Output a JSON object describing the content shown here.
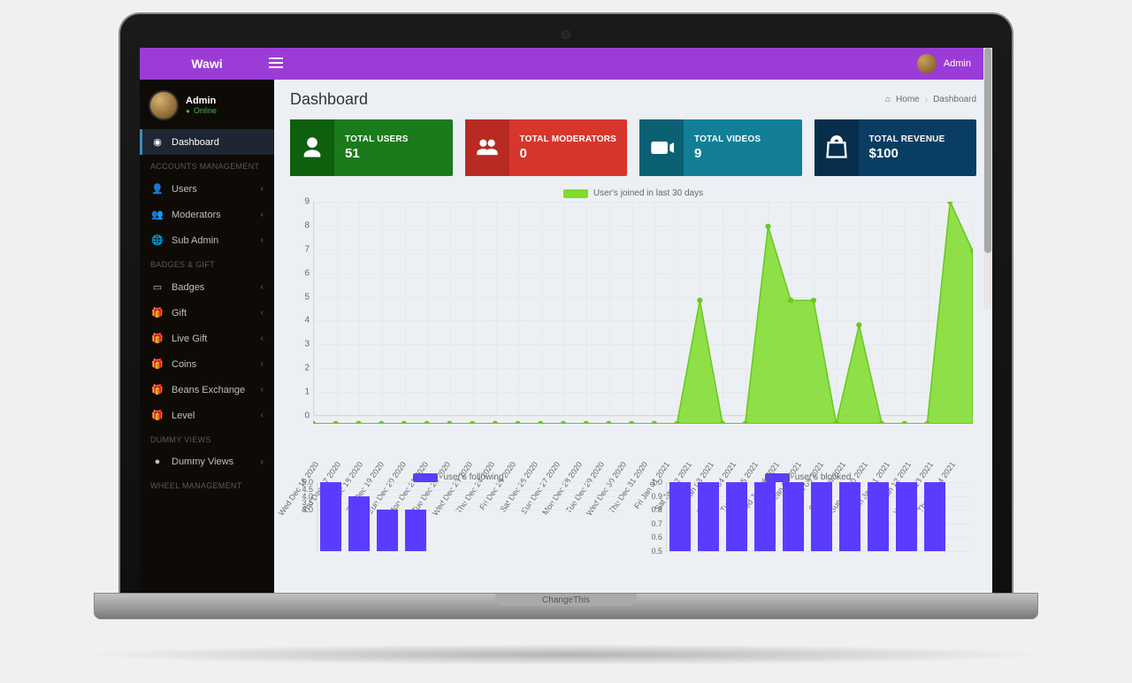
{
  "laptop_base_label": "ChangeThis",
  "topbar": {
    "brand": "Wawi",
    "user_name": "Admin"
  },
  "sidebar": {
    "profile": {
      "name": "Admin",
      "status": "Online"
    },
    "sections": [
      {
        "items": [
          {
            "icon": "dashboard-icon",
            "label": "Dashboard",
            "active": true,
            "expandable": false
          }
        ]
      },
      {
        "header": "ACCOUNTS MANAGEMENT",
        "items": [
          {
            "icon": "user-icon",
            "label": "Users",
            "expandable": true
          },
          {
            "icon": "users-icon",
            "label": "Moderators",
            "expandable": true
          },
          {
            "icon": "globe-icon",
            "label": "Sub Admin",
            "expandable": true
          }
        ]
      },
      {
        "header": "BADGES & GIFT",
        "items": [
          {
            "icon": "book-icon",
            "label": "Badges",
            "expandable": true
          },
          {
            "icon": "gift-icon",
            "label": "Gift",
            "expandable": true
          },
          {
            "icon": "gift-icon",
            "label": "Live Gift",
            "expandable": true
          },
          {
            "icon": "gift-icon",
            "label": "Coins",
            "expandable": true
          },
          {
            "icon": "gift-icon",
            "label": "Beans Exchange",
            "expandable": true
          },
          {
            "icon": "gift-icon",
            "label": "Level",
            "expandable": true
          }
        ]
      },
      {
        "header": "Dummy Views",
        "items": [
          {
            "icon": "circle-icon",
            "label": "Dummy Views",
            "expandable": true
          }
        ]
      },
      {
        "header": "WHEEL MANAGEMENT",
        "items": []
      }
    ]
  },
  "page": {
    "title": "Dashboard"
  },
  "breadcrumb": {
    "home": "Home",
    "current": "Dashboard"
  },
  "cards": [
    {
      "color": "green",
      "label": "TOTAL USERS",
      "value": "51",
      "icon": "user"
    },
    {
      "color": "red",
      "label": "TOTAL MODERATORS",
      "value": "0",
      "icon": "users"
    },
    {
      "color": "teal",
      "label": "TOTAL VIDEOS",
      "value": "9",
      "icon": "video"
    },
    {
      "color": "navy",
      "label": "TOTAL REVENUE",
      "value": "$100",
      "icon": "bag"
    }
  ],
  "chart_data": [
    {
      "type": "area",
      "title": "User's joined in last 30 days",
      "categories": [
        "Wed Dec 16 2020",
        "Thu Dec 17 2020",
        "Fri Dec 18 2020",
        "Sat Dec 19 2020",
        "Sun Dec 20 2020",
        "Mon Dec 21 2020",
        "Tue Dec 22 2020",
        "Wed Dec 23 2020",
        "Thu Dec 24 2020",
        "Fri Dec 25 2020",
        "Sat Dec 26 2020",
        "Sun Dec 27 2020",
        "Mon Dec 28 2020",
        "Tue Dec 29 2020",
        "Wed Dec 30 2020",
        "Thu Dec 31 2020",
        "Fri Jan 01 2021",
        "Sat Jan 02 2021",
        "Sun Jan 03 2021",
        "Mon Jan 04 2021",
        "Tue Jan 05 2021",
        "Wed Jan 06 2021",
        "Thu Jan 07 2021",
        "Fri Jan 08 2021",
        "Sat Jan 09 2021",
        "Sun Jan 10 2021",
        "Mon Jan 11 2021",
        "Tue Jan 12 2021",
        "Wed Jan 13 2021",
        "Thu Jan 14 2021"
      ],
      "values": [
        0,
        0,
        0,
        0,
        0,
        0,
        0,
        0,
        0,
        0,
        0,
        0,
        0,
        0,
        0,
        0,
        0,
        5,
        0,
        0,
        8,
        5,
        5,
        0,
        4,
        0,
        0,
        0,
        9,
        7
      ],
      "ylim": [
        0,
        9
      ],
      "ylabel": "",
      "xlabel": ""
    },
    {
      "type": "bar",
      "title": "user's following",
      "values": [
        5,
        4,
        3,
        3,
        0,
        0,
        0,
        0,
        0,
        0
      ],
      "ylim": [
        0,
        5
      ],
      "yticks": [
        3.0,
        3.5,
        4.0,
        4.5,
        5.0
      ]
    },
    {
      "type": "bar",
      "title": "user's blocked",
      "values": [
        1,
        1,
        1,
        1,
        1,
        1,
        1,
        1,
        1,
        1
      ],
      "ylim": [
        0.5,
        1.0
      ],
      "yticks": [
        0.5,
        0.6,
        0.7,
        0.8,
        0.9,
        1.0
      ]
    }
  ]
}
